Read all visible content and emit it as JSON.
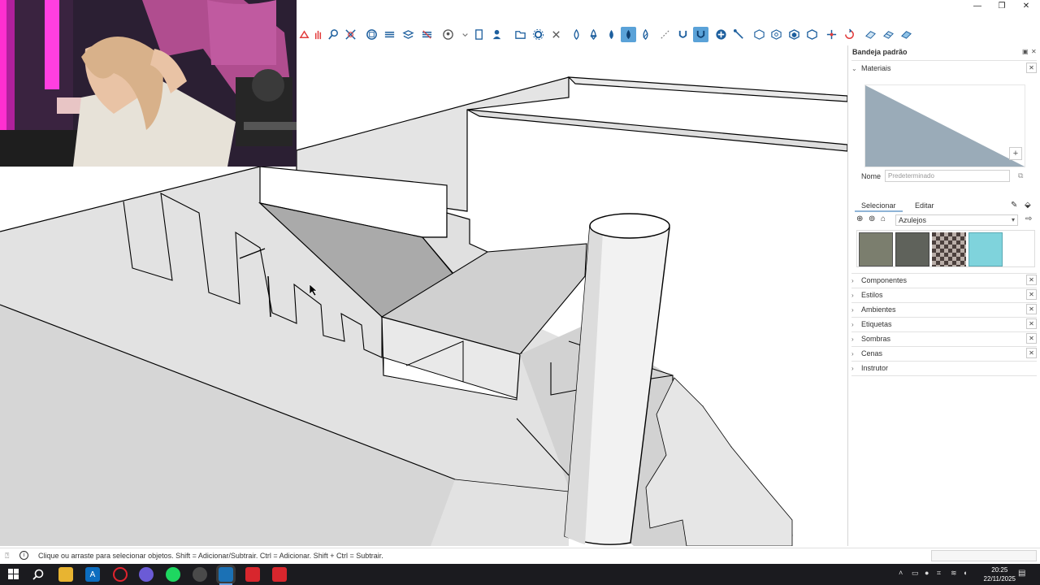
{
  "window": {
    "minimize": "—",
    "restore": "❐",
    "close": "✕"
  },
  "tray": {
    "title": "Bandeja padrão",
    "materials": {
      "section_label": "Materiais",
      "name_label": "Nome",
      "name_placeholder": "Predeterminado",
      "tab_select": "Selecionar",
      "tab_edit": "Editar",
      "collection": "Azulejos",
      "swatch_colors": [
        "#7b7e6e",
        "#5f625b",
        "#8a7e78",
        "#7fd3dc"
      ]
    },
    "sections": [
      {
        "label": "Componentes"
      },
      {
        "label": "Estilos"
      },
      {
        "label": "Ambientes"
      },
      {
        "label": "Etiquetas"
      },
      {
        "label": "Sombras"
      },
      {
        "label": "Cenas"
      },
      {
        "label": "Instrutor"
      }
    ]
  },
  "status": {
    "hint": "Clique ou arraste para selecionar objetos. Shift = Adicionar/Subtrair. Ctrl = Adicionar. Shift + Ctrl = Subtrair."
  },
  "taskbar": {
    "time": "20:25",
    "date": "22/11/2025"
  },
  "colors": {
    "accent": "#5aa2d8",
    "toolbar_icon": "#1d5f9e"
  }
}
